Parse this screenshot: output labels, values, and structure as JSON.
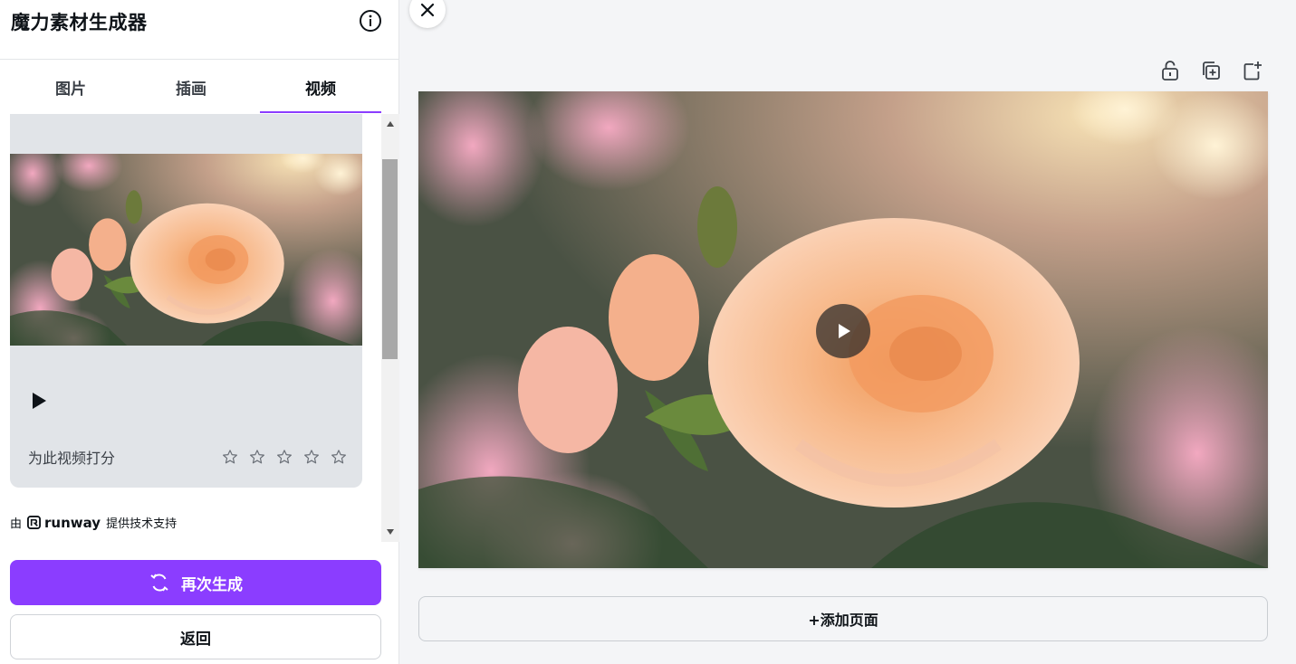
{
  "panel": {
    "title": "魔力素材生成器",
    "tabs": [
      {
        "label": "图片",
        "active": false
      },
      {
        "label": "插画",
        "active": false
      },
      {
        "label": "视频",
        "active": true
      }
    ],
    "card": {
      "rate_label": "为此视频打分",
      "star_count": 5,
      "rating": 0
    },
    "powered_by": {
      "prefix": "由",
      "brand": "runway",
      "suffix": "提供技术支持"
    },
    "regenerate_label": "再次生成",
    "back_label": "返回"
  },
  "editor": {
    "add_page_label": "+添加页面",
    "toolbar_icons": [
      "unlock-icon",
      "duplicate-page-icon",
      "add-page-icon"
    ]
  },
  "colors": {
    "accent": "#8b3dff",
    "card_bg": "#e1e4e8",
    "canvas_bg": "#f4f5f7"
  }
}
